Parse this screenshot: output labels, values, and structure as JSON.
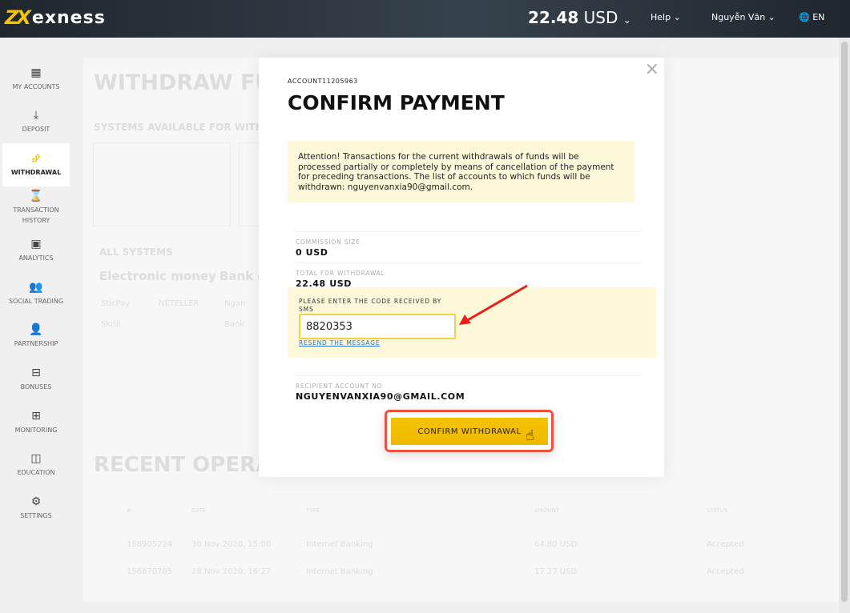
{
  "header": {
    "logo": "exness",
    "balance_amount": "22.48",
    "balance_currency": "USD",
    "help": "Help",
    "user": "Nguyễn Văn",
    "lang": "EN"
  },
  "sidebar": {
    "items": [
      {
        "label": "MY ACCOUNTS",
        "icon": "grid-icon"
      },
      {
        "label": "DEPOSIT",
        "icon": "download-icon"
      },
      {
        "label": "WITHDRAWAL",
        "icon": "upload-arrow-icon",
        "active": true
      },
      {
        "label": "TRANSACTION HISTORY",
        "icon": "hourglass-icon"
      },
      {
        "label": "ANALYTICS",
        "icon": "chart-board-icon"
      },
      {
        "label": "SOCIAL TRADING",
        "icon": "people-icon"
      },
      {
        "label": "PARTNERSHIP",
        "icon": "handshake-icon"
      },
      {
        "label": "BONUSES",
        "icon": "gift-icon"
      },
      {
        "label": "MONITORING",
        "icon": "briefcase-icon"
      },
      {
        "label": "EDUCATION",
        "icon": "book-icon"
      },
      {
        "label": "SETTINGS",
        "icon": "gear-icon"
      }
    ]
  },
  "background": {
    "title": "WITHDRAW FUNDS",
    "systems_available": "SYSTEMS AVAILABLE FOR WITHDRAWAL",
    "all_systems": "ALL SYSTEMS",
    "tab_electronic": "Electronic money",
    "tab_bank": "Bank cards",
    "methods": [
      "SticPay",
      "NETELLER",
      "Ngan",
      "Skrill",
      "Bank"
    ],
    "recent_title": "RECENT OPERATIONS",
    "table": {
      "headers": [
        "#",
        "DATE",
        "TYPE",
        "AMOUNT",
        "STATUS"
      ],
      "rows": [
        [
          "156905224",
          "30 Nov 2020, 15:00",
          "Internet Banking",
          "64.80 USD",
          "Accepted"
        ],
        [
          "156670785",
          "28 Nov 2020, 16:27",
          "Internet Banking",
          "17.27 USD",
          "Accepted"
        ]
      ]
    }
  },
  "modal": {
    "account": "ACCOUNT11205963",
    "title": "CONFIRM PAYMENT",
    "notice": "Attention! Transactions for the current withdrawals of funds will be processed partially or completely by means of cancellation of the payment for preceding transactions. The list of accounts to which funds will be withdrawn: nguyenvanxia90@gmail.com.",
    "commission_label": "COMMISSION SIZE",
    "commission_value": "0 USD",
    "total_label": "TOTAL FOR WITHDRAWAL",
    "total_value": "22.48 USD",
    "sms_label": "PLEASE ENTER THE CODE RECEIVED BY SMS",
    "sms_value": "8820353",
    "resend": "RESEND THE MESSAGE",
    "recipient_label": "RECIPIENT ACCOUNT NO",
    "recipient_value": "NGUYENVANXIA90@GMAIL.COM",
    "confirm": "CONFIRM WITHDRAWAL",
    "close": "×"
  },
  "colors": {
    "accent": "#f5c400",
    "highlight": "#f0503c",
    "notice_bg": "#fdf8d9",
    "link": "#2a72c8"
  }
}
